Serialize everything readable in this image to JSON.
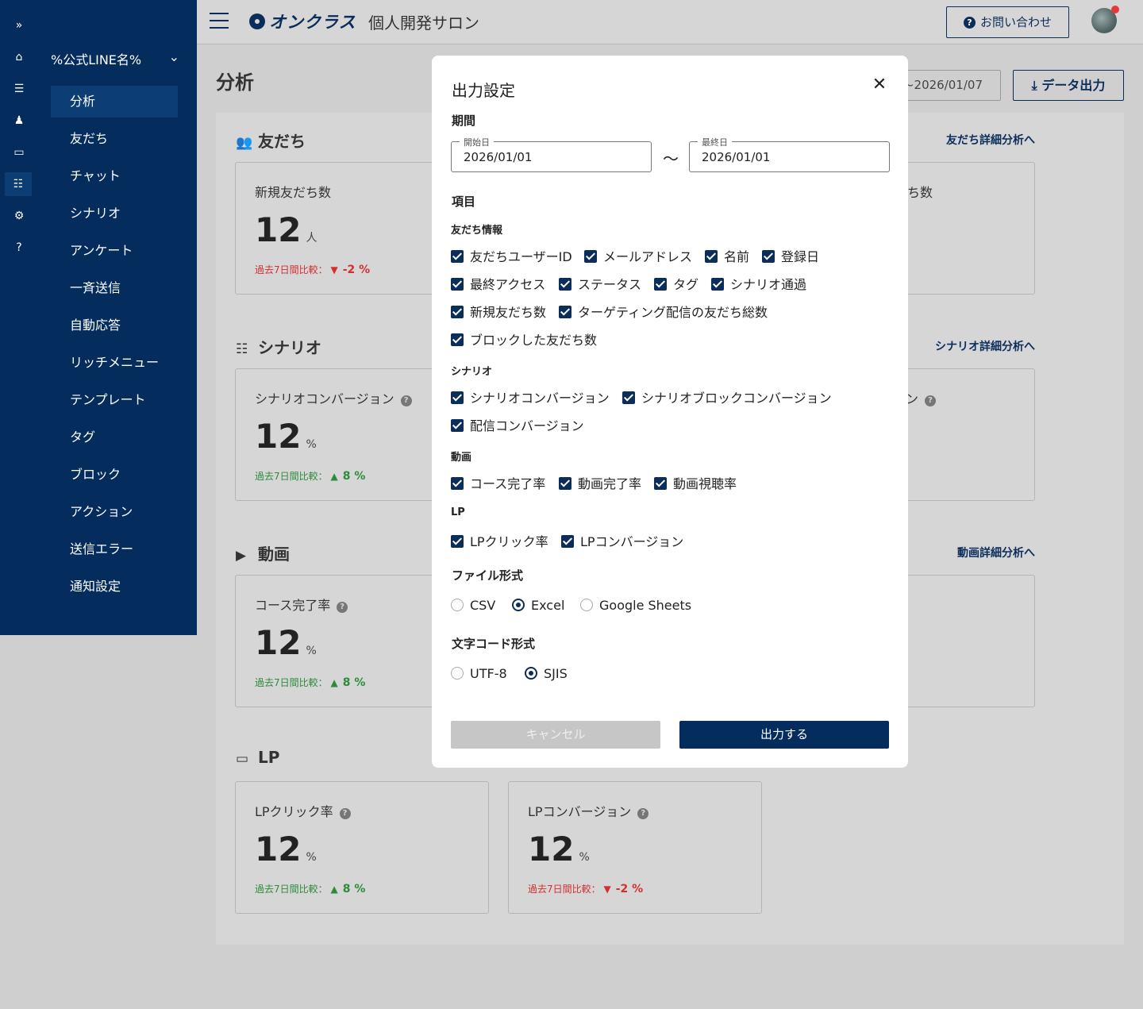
{
  "rail": {
    "expand_icon": "double-chevron-right-icon",
    "items": [
      "home-icon",
      "list-icon",
      "user-settings-icon",
      "window-icon",
      "layers-icon",
      "gear-icon",
      "help-icon"
    ]
  },
  "sidebar": {
    "account": "%公式LINE名%",
    "items": [
      "分析",
      "友だち",
      "チャット",
      "シナリオ",
      "アンケート",
      "一斉送信",
      "自動応答",
      "リッチメニュー",
      "テンプレート",
      "タグ",
      "ブロック",
      "アクション",
      "送信エラー",
      "通知設定"
    ],
    "active_index": 0
  },
  "header": {
    "brand": "オンクラス",
    "site_title": "個人開発サロン",
    "contact_label": "お問い合わせ"
  },
  "page": {
    "title": "分析",
    "date_range": "~2026/01/07",
    "export_label": "データ出力",
    "sections": {
      "friends": {
        "title": "友だち",
        "link": "友だち詳細分析へ"
      },
      "scenario": {
        "title": "シナリオ",
        "link": "シナリオ詳細分析へ"
      },
      "video": {
        "title": "動画",
        "link": "動画詳細分析へ"
      },
      "lp": {
        "title": "LP"
      }
    },
    "cards": {
      "friends_new": {
        "label": "新規友だち数",
        "value": "12",
        "unit": "人",
        "compare_label": "過去7日間比較：",
        "compare_value": "-2 %"
      },
      "friends_right": {
        "label": "ち数"
      },
      "scenario_conv": {
        "label": "シナリオコンバージョン",
        "value": "12",
        "unit": "%",
        "compare_label": "過去7日間比較：",
        "compare_value": "8 %"
      },
      "scenario_right": {
        "label": "ン"
      },
      "video_course": {
        "label": "コース完了率",
        "value": "12",
        "unit": "%",
        "compare_label": "過去7日間比較：",
        "compare_value": "8 %"
      },
      "lp_click": {
        "label": "LPクリック率",
        "value": "12",
        "unit": "%",
        "compare_label": "過去7日間比較：",
        "compare_value": "8 %"
      },
      "lp_conv": {
        "label": "LPコンバージョン",
        "value": "12",
        "unit": "%",
        "compare_label": "過去7日間比較：",
        "compare_value": "-2 %"
      }
    }
  },
  "modal": {
    "title": "出力設定",
    "period_heading": "期間",
    "start_label": "開始日",
    "start_value": "2026/01/01",
    "tilde": "〜",
    "end_label": "最終日",
    "end_value": "2026/01/01",
    "items_heading": "項目",
    "friend_info": {
      "heading": "友だち情報",
      "items": [
        "友だちユーザーID",
        "メールアドレス",
        "名前",
        "登録日",
        "最終アクセス",
        "ステータス",
        "タグ",
        "シナリオ通過",
        "新規友だち数",
        "ターゲティング配信の友だち総数",
        "ブロックした友だち数"
      ]
    },
    "scenario": {
      "heading": "シナリオ",
      "items": [
        "シナリオコンバージョン",
        "シナリオブロックコンバージョン",
        "配信コンバージョン"
      ]
    },
    "video": {
      "heading": "動画",
      "items": [
        "コース完了率",
        "動画完了率",
        "動画視聴率"
      ]
    },
    "lp": {
      "heading": "LP",
      "items": [
        "LPクリック率",
        "LPコンバージョン"
      ]
    },
    "file_format": {
      "heading": "ファイル形式",
      "options": [
        "CSV",
        "Excel",
        "Google Sheets"
      ],
      "selected": "Excel"
    },
    "encoding": {
      "heading": "文字コード形式",
      "options": [
        "UTF-8",
        "SJIS"
      ],
      "selected": "SJIS"
    },
    "cancel_label": "キャンセル",
    "submit_label": "出力する"
  },
  "colors": {
    "navy": "#042d5d",
    "up": "#2e8b3a",
    "down": "#d32f2f"
  }
}
